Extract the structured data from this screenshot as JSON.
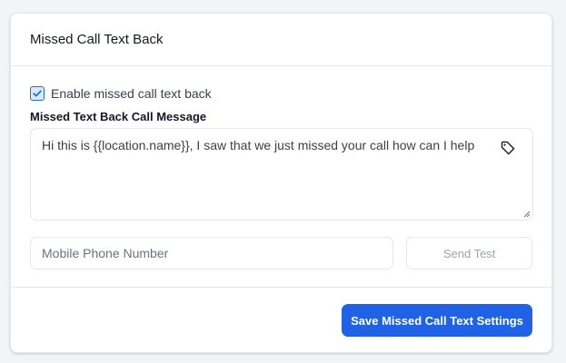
{
  "card": {
    "title": "Missed Call Text Back"
  },
  "enable_checkbox": {
    "label": "Enable missed call text back",
    "checked": true
  },
  "message": {
    "label": "Missed Text Back Call Message",
    "value": "Hi this is {{location.name}}, I saw that we just missed your call how can I help",
    "tag_icon": "tag-icon"
  },
  "phone": {
    "placeholder": "Mobile Phone Number",
    "value": ""
  },
  "send_test": {
    "label": "Send Test"
  },
  "save": {
    "label": "Save Missed Call Text Settings"
  },
  "colors": {
    "accent": "#1f62e6",
    "border": "#e5e7eb",
    "text": "#111827"
  }
}
